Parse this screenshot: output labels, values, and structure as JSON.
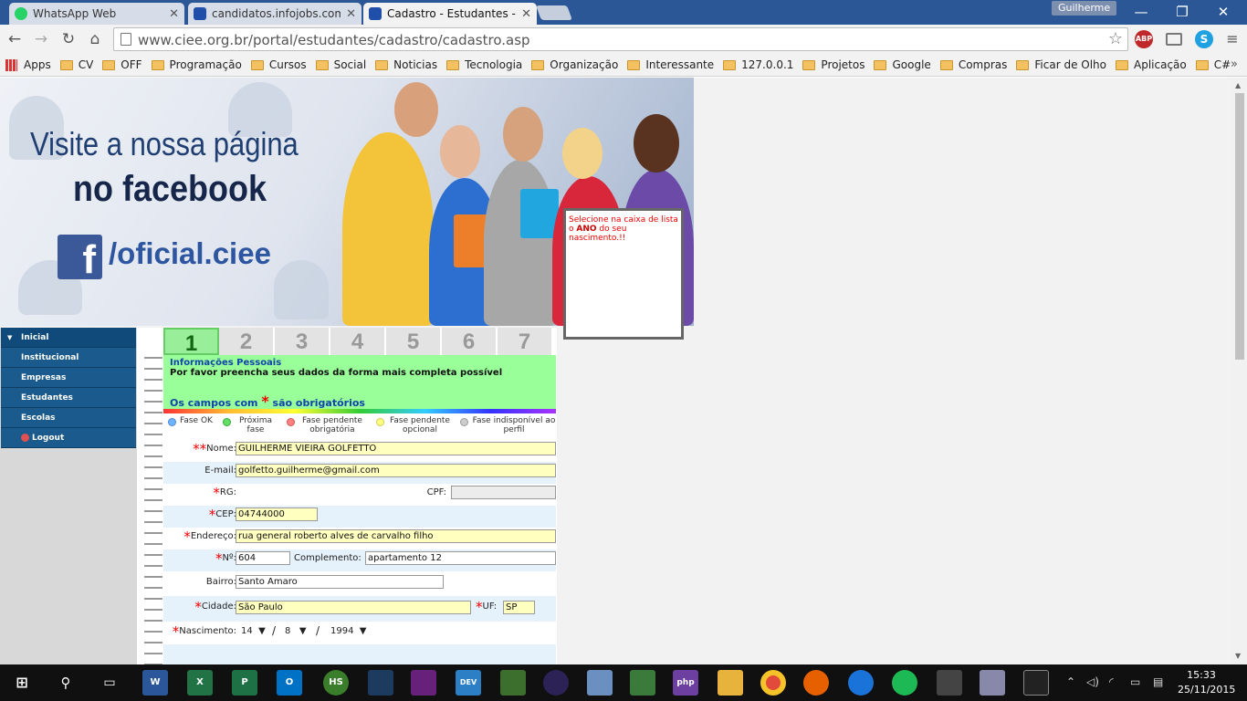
{
  "browser": {
    "tabs": [
      {
        "title": "WhatsApp Web",
        "favicon_color": "#25d366"
      },
      {
        "title": "candidatos.infojobs.com.b",
        "favicon_color": "#1f4fa8"
      },
      {
        "title": "Cadastro - Estudantes - C",
        "favicon_color": "#1f4fa8"
      }
    ],
    "user": "Guilherme",
    "url": "www.ciee.org.br/portal/estudantes/cadastro/cadastro.asp",
    "adblock_label": "ABP",
    "bookmarks": [
      "CV",
      "OFF",
      "Programação",
      "Cursos",
      "Social",
      "Noticias",
      "Tecnologia",
      "Organização",
      "Interessante",
      "127.0.0.1",
      "Projetos",
      "Google",
      "Compras",
      "Ficar de Olho",
      "Aplicação",
      "C#"
    ],
    "apps_label": "Apps"
  },
  "banner": {
    "line1": "Visite a nossa página",
    "line2": "no facebook",
    "handle": "/oficial.ciee",
    "fb_letter": "f"
  },
  "tooltip": {
    "text_before": "Selecione na caixa de lista o ",
    "highlight": "ANO",
    "text_after": " do seu nascimento.!!"
  },
  "menu": {
    "items": [
      "Inicial",
      "Institucional",
      "Empresas",
      "Estudantes",
      "Escolas",
      "Logout"
    ]
  },
  "steps": [
    "1",
    "2",
    "3",
    "4",
    "5",
    "6",
    "7"
  ],
  "form_header": {
    "title": "Informações Pessoais",
    "subtitle": "Por favor preencha seus dados da forma mais completa possível",
    "required_prefix": "Os campos com",
    "required_mark": "*",
    "required_suffix": "são obrigatórios"
  },
  "legend": [
    {
      "label": "Fase OK",
      "color": "#6fb3ff"
    },
    {
      "label": "Próxima fase",
      "color": "#66dd66"
    },
    {
      "label": "Fase pendente obrigatória",
      "color": "#ff8080"
    },
    {
      "label": "Fase pendente opcional",
      "color": "#ffff80"
    },
    {
      "label": "Fase indisponível ao perfil",
      "color": "#cccccc"
    }
  ],
  "fields": {
    "nome_label": "Nome:",
    "nome": "GUILHERME VIEIRA GOLFETTO",
    "email_label": "E-mail:",
    "email": "golfetto.guilherme@gmail.com",
    "rg_label": "RG:",
    "rg": "",
    "cpf_label": "CPF:",
    "cpf": "",
    "cep_label": "CEP:",
    "cep": "04744000",
    "endereco_label": "Endereço:",
    "endereco": "rua general roberto alves de carvalho filho",
    "numero_label": "Nº:",
    "numero": "604",
    "complemento_label": "Complemento:",
    "complemento": "apartamento 12",
    "bairro_label": "Bairro:",
    "bairro": "Santo Amaro",
    "cidade_label": "Cidade:",
    "cidade": "São Paulo",
    "uf_label": "UF:",
    "uf": "SP",
    "nascimento_label": "Nascimento:",
    "dia": "14",
    "mes": "8",
    "ano": "1994",
    "sep": "/"
  },
  "taskbar": {
    "time": "15:33",
    "date": "25/11/2015",
    "apps": [
      "W",
      "X",
      "P",
      "O",
      "HS",
      "",
      "",
      "DEV",
      "",
      "",
      "",
      "",
      "php",
      "",
      "",
      "",
      "",
      "",
      "",
      ""
    ]
  }
}
